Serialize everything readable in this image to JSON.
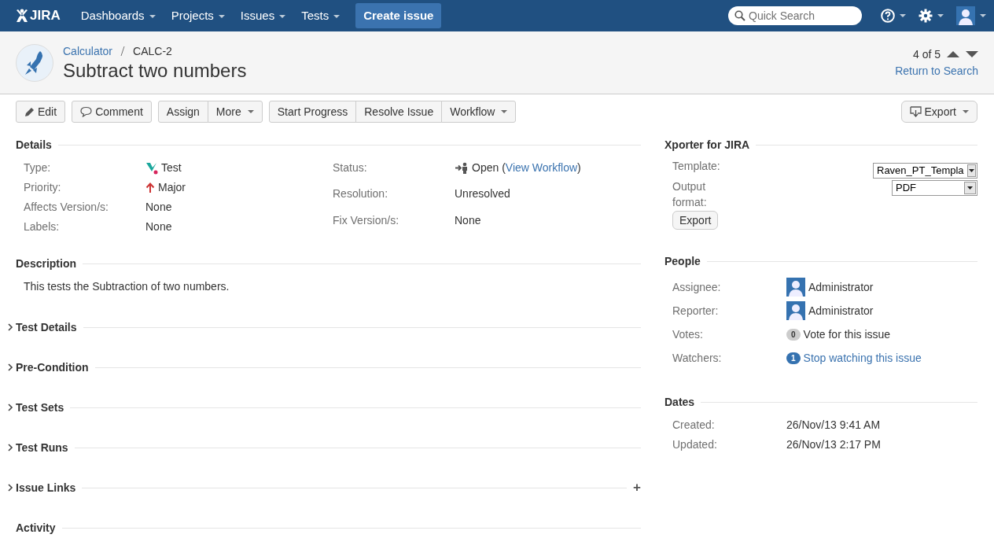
{
  "nav": {
    "logo": "JIRA",
    "menus": [
      {
        "label": "Dashboards"
      },
      {
        "label": "Projects"
      },
      {
        "label": "Issues"
      },
      {
        "label": "Tests"
      }
    ],
    "create": "Create issue",
    "search": {
      "placeholder": "Quick Search"
    }
  },
  "header": {
    "project": "Calculator",
    "key": "CALC-2",
    "title": "Subtract two numbers",
    "pager": "4 of 5",
    "return_link": "Return to Search"
  },
  "toolbar": {
    "groups": [
      [
        {
          "label": "Edit",
          "kind": "edit"
        }
      ],
      [
        {
          "label": "Comment",
          "kind": "comment"
        }
      ],
      [
        {
          "label": "Assign",
          "kind": "plain"
        },
        {
          "label": "More",
          "kind": "dropdown"
        }
      ],
      [
        {
          "label": "Start Progress",
          "kind": "plain"
        },
        {
          "label": "Resolve Issue",
          "kind": "plain"
        },
        {
          "label": "Workflow",
          "kind": "dropdown"
        }
      ]
    ],
    "export": "Export"
  },
  "details": {
    "title": "Details",
    "left": [
      {
        "label": "Type:",
        "value": "Test",
        "kind": "issue-type"
      },
      {
        "label": "Priority:",
        "value": "Major",
        "kind": "priority"
      },
      {
        "label": "Affects Version/s:",
        "value": "None",
        "kind": "plain"
      },
      {
        "label": "Labels:",
        "value": "None",
        "kind": "plain"
      }
    ],
    "right": [
      {
        "label": "Status:",
        "value": "Open (",
        "kind": "status",
        "link": "View Workflow",
        "after": ")"
      },
      {
        "label": "Resolution:",
        "value": "Unresolved",
        "kind": "plain"
      },
      {
        "label": "Fix Version/s:",
        "value": "None",
        "kind": "plain"
      }
    ]
  },
  "description": {
    "title": "Description",
    "text": "This tests the Subtraction of two numbers."
  },
  "sections": [
    {
      "title": "Test Details",
      "kind": "toggle",
      "expanded": false
    },
    {
      "title": "Pre-Condition",
      "kind": "toggle",
      "expanded": false
    },
    {
      "title": "Test Sets",
      "kind": "toggle",
      "expanded": false
    },
    {
      "title": "Test Runs",
      "kind": "toggle",
      "expanded": false
    },
    {
      "title": "Issue Links",
      "kind": "toggle",
      "expanded": false,
      "add": "+"
    },
    {
      "title": "Activity",
      "kind": "plain"
    }
  ],
  "xporter": {
    "title": "Xporter for JIRA",
    "template_label": "Template:",
    "template": "Raven_PT_Templa",
    "format_label": "Output format:",
    "format": "PDF",
    "button": "Export"
  },
  "people": {
    "title": "People",
    "rows": [
      {
        "label": "Assignee:",
        "kind": "user",
        "value": "Administrator"
      },
      {
        "label": "Reporter:",
        "kind": "user",
        "value": "Administrator"
      },
      {
        "label": "Votes:",
        "kind": "count",
        "count": "0",
        "color": "#cccccc",
        "value": "Vote for this issue",
        "link": false
      },
      {
        "label": "Watchers:",
        "kind": "count",
        "count": "1",
        "color": "#3572b0",
        "value": "Stop watching this issue",
        "link": true
      }
    ]
  },
  "dates": {
    "title": "Dates",
    "rows": [
      {
        "label": "Created:",
        "value": "26/Nov/13 9:41 AM"
      },
      {
        "label": "Updated:",
        "value": "26/Nov/13 2:17 PM"
      }
    ]
  }
}
